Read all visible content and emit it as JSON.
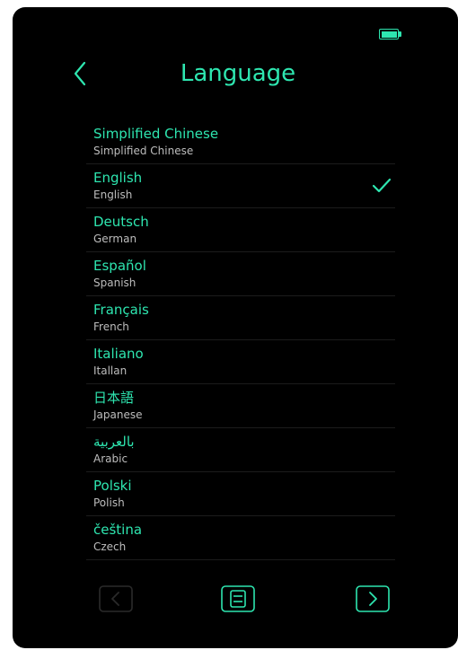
{
  "header": {
    "title": "Language",
    "back_icon": "chevron-left-icon"
  },
  "status_bar": {
    "battery_icon": "battery-full-icon"
  },
  "languages": [
    {
      "native": "Simplified Chinese",
      "english": "Simplified Chinese",
      "selected": false
    },
    {
      "native": "English",
      "english": "English",
      "selected": true
    },
    {
      "native": "Deutsch",
      "english": "German",
      "selected": false
    },
    {
      "native": "Español",
      "english": "Spanish",
      "selected": false
    },
    {
      "native": "Français",
      "english": "French",
      "selected": false
    },
    {
      "native": "Italiano",
      "english": "Itallan",
      "selected": false
    },
    {
      "native": "日本語",
      "english": "Japanese",
      "selected": false
    },
    {
      "native": "بالعربية",
      "english": "Arabic",
      "selected": false
    },
    {
      "native": "Polski",
      "english": "Polish",
      "selected": false
    },
    {
      "native": "čeština",
      "english": "Czech",
      "selected": false
    }
  ],
  "bottom_bar": {
    "prev_icon": "chevron-left-box-icon",
    "save_icon": "save-icon",
    "next_icon": "chevron-right-box-icon",
    "prev_enabled": false
  },
  "colors": {
    "accent": "#2ee6b0",
    "background": "#000000",
    "secondary_text": "#bdbdbd",
    "disabled": "#2a2a2a"
  }
}
